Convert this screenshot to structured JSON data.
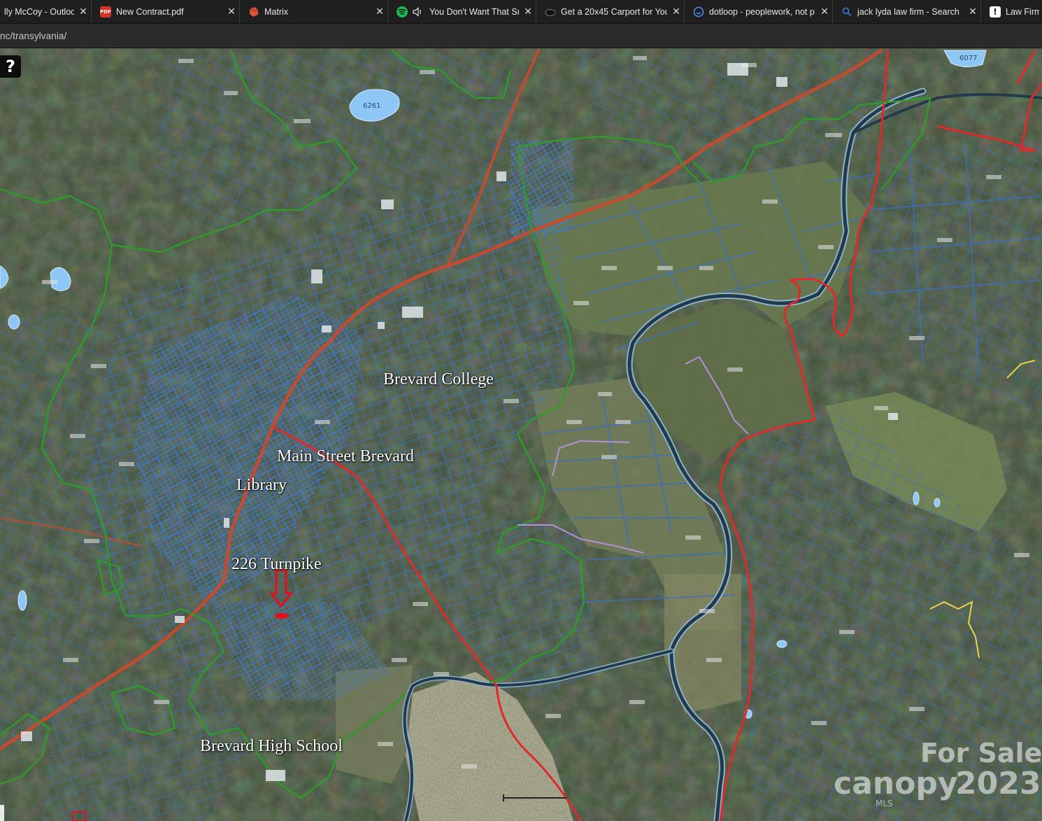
{
  "browser": {
    "tabs": [
      {
        "title": "lly McCoy - Outlook",
        "icon": "outlook-icon",
        "icon_color": "#0a64c9"
      },
      {
        "title": "New Contract.pdf",
        "icon": "pdf-icon",
        "icon_color": "#d93025"
      },
      {
        "title": "Matrix",
        "icon": "matrix-icon",
        "icon_color": "#d9553a"
      },
      {
        "title": "You Don't Want That Sn",
        "icon": "spotify-icon",
        "icon_color": "#1db954"
      },
      {
        "title": "Get a 20x45 Carport for Your",
        "icon": "cloud-icon",
        "icon_color": "#9aa0a6"
      },
      {
        "title": "dotloop - peoplework, not p",
        "icon": "dotloop-icon",
        "icon_color": "#4a8df0"
      },
      {
        "title": "jack lyda law firm - Search",
        "icon": "search-icon",
        "icon_color": "#3b78e7"
      },
      {
        "title": "Law Firm",
        "icon": "alert-icon",
        "icon_color": "#ffffff"
      }
    ],
    "close_glyph": "✕",
    "url": "nc/transylvania/"
  },
  "map": {
    "help_glyph": "?",
    "labels": {
      "brevard_college": "Brevard College",
      "main_street": "Main Street Brevard",
      "library": "Library",
      "turnpike": "226 Turnpike",
      "high_school": "Brevard High School"
    },
    "lake_label": "6261",
    "lake_label_2": "6077",
    "watermark": {
      "for_sale": "For Sale",
      "brand": "canopy",
      "year": "2023",
      "mls": "MLS"
    },
    "colors": {
      "parcel_lines": "#2f6fd0",
      "red_boundary": "#e02a2a",
      "green_boundary": "#2f9a2a",
      "water": "#8ec7f5",
      "marker": "#e3101c"
    }
  }
}
